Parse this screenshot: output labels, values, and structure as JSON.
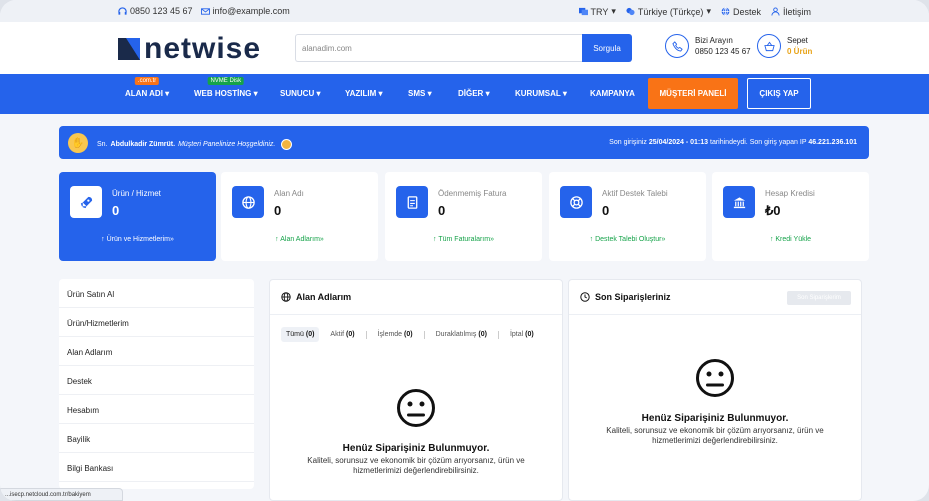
{
  "topbar": {
    "phone": "0850 123 45 67",
    "email": "info@example.com",
    "currency": "TRY",
    "language": "Türkiye (Türkçe)",
    "support": "Destek",
    "contact": "İletişim"
  },
  "header": {
    "logo": "netwise",
    "search_placeholder": "alanadim.com",
    "search_button": "Sorgula",
    "call_title": "Bizi Arayın",
    "call_number": "0850 123 45 67",
    "cart_title": "Sepet",
    "cart_count": "0 Ürün"
  },
  "nav": {
    "items": [
      {
        "label": "ALAN ADI",
        "badge": ".com.tr"
      },
      {
        "label": "WEB HOSTİNG",
        "badge": "NVME Disk"
      },
      {
        "label": "SUNUCU"
      },
      {
        "label": "YAZILIM"
      },
      {
        "label": "SMS"
      },
      {
        "label": "DİĞER"
      },
      {
        "label": "KURUMSAL"
      },
      {
        "label": "KAMPANYA"
      }
    ],
    "panel_button": "MÜŞTERİ PANELİ",
    "logout_button": "ÇIKIŞ YAP"
  },
  "welcome": {
    "prefix": "Sn.",
    "name": "Abdulkadir Zümrüt.",
    "message": "Müşteri Panelinize Hoşgeldiniz.",
    "last_login_prefix": "Son girişiniz",
    "last_login_date": "25/04/2024 - 01:13",
    "last_login_suffix": "tarihindeydi. Son giriş yapan IP",
    "last_ip": "46.221.236.101"
  },
  "cards": [
    {
      "label": "Ürün / Hizmet",
      "value": "0",
      "link": "Ürün ve Hizmetlerim»",
      "icon": "rocket-icon"
    },
    {
      "label": "Alan Adı",
      "value": "0",
      "link": "Alan Adlarım»",
      "icon": "globe-icon"
    },
    {
      "label": "Ödenmemiş Fatura",
      "value": "0",
      "link": "Tüm Faturalarım»",
      "icon": "invoice-icon"
    },
    {
      "label": "Aktif Destek Talebi",
      "value": "0",
      "link": "Destek Talebi Oluştur»",
      "icon": "lifebuoy-icon"
    },
    {
      "label": "Hesap Kredisi",
      "value": "₺0",
      "link": "Kredi Yükle",
      "icon": "bank-icon"
    }
  ],
  "sidebar": {
    "items": [
      "Ürün Satın Al",
      "Ürün/Hizmetlerim",
      "Alan Adlarım",
      "Destek",
      "Hesabım",
      "Bayilik",
      "Bilgi Bankası"
    ]
  },
  "domains_panel": {
    "title": "Alan Adlarım",
    "tabs": [
      {
        "label": "Tümü",
        "count": "(0)"
      },
      {
        "label": "Aktif",
        "count": "(0)"
      },
      {
        "label": "İşlemde",
        "count": "(0)"
      },
      {
        "label": "Duraklatılmış",
        "count": "(0)"
      },
      {
        "label": "İptal",
        "count": "(0)"
      }
    ],
    "empty_title": "Henüz Siparişiniz Bulunmuyor.",
    "empty_text_1": "Kaliteli, sorunsuz ve ekonomik bir çözüm arıyorsanız, ürün ve",
    "empty_text_2": "hizmetlerimizi değerlendirebilirsiniz."
  },
  "orders_panel": {
    "title": "Son Siparişleriniz",
    "button": "Son Siparişlerim",
    "empty_title": "Henüz Siparişiniz Bulunmuyor.",
    "empty_text_1": "Kaliteli, sorunsuz ve ekonomik bir çözüm arıyorsanız, ürün ve",
    "empty_text_2": "hizmetlerimizi değerlendirebilirsiniz."
  },
  "statusbar": {
    "url": "...isecp.netcloud.com.tr/bakiyem"
  },
  "colors": {
    "primary": "#2563eb",
    "accent": "#f97316",
    "success": "#16a34a",
    "dark": "#1a2a4a"
  }
}
